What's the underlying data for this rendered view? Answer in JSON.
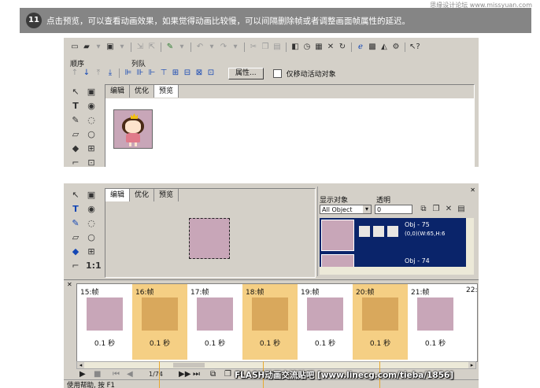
{
  "banner": {
    "step": "11",
    "text": "点击预览，可以查看动画效果，如果觉得动画比较慢，可以间隔删除帧或者调整画面帧属性的延迟。",
    "watermark": "思缘设计论坛 www.missyuan.com"
  },
  "window1": {
    "order_label": "顺序",
    "align_label": "列队",
    "properties_button": "属性...",
    "move_active_only": "仅移动活动对象",
    "tabs": [
      "编辑",
      "优化",
      "预览"
    ]
  },
  "window2": {
    "tabs": [
      "编辑",
      "优化",
      "预览"
    ],
    "objects_panel": {
      "show_objects_label": "显示对象",
      "opacity_label": "透明",
      "filter_value": "All Object",
      "opacity_value": "0",
      "obj1_name": "Obj - 75",
      "obj1_info": "(0,0)(W:65,H:6",
      "obj2_name": "Obj - 74"
    },
    "frames": [
      {
        "label": "15:帧",
        "delay": "0.1 秒",
        "selected": false
      },
      {
        "label": "16:帧",
        "delay": "0.1 秒",
        "selected": true
      },
      {
        "label": "17:帧",
        "delay": "0.1 秒",
        "selected": false
      },
      {
        "label": "18:帧",
        "delay": "0.1 秒",
        "selected": true
      },
      {
        "label": "19:帧",
        "delay": "0.1 秒",
        "selected": false
      },
      {
        "label": "20:帧",
        "delay": "0.1 秒",
        "selected": true
      },
      {
        "label": "21:帧",
        "delay": "0.1 秒",
        "selected": false
      },
      {
        "label": "22:",
        "delay": "",
        "selected": false
      }
    ],
    "playback": {
      "frame_counter": "1/74"
    },
    "status_text": "使用帮助, 按 F1",
    "credit": "FLASH动画交流贴吧 [www.linecg.com/tieba/1856]"
  },
  "colors": {
    "banner_bg": "#858585",
    "window_bg": "#d4d0c8",
    "selected_frame": "#f5cf84",
    "canvas_fill": "#c8a6b8",
    "object_list_bg": "#0a246a"
  }
}
